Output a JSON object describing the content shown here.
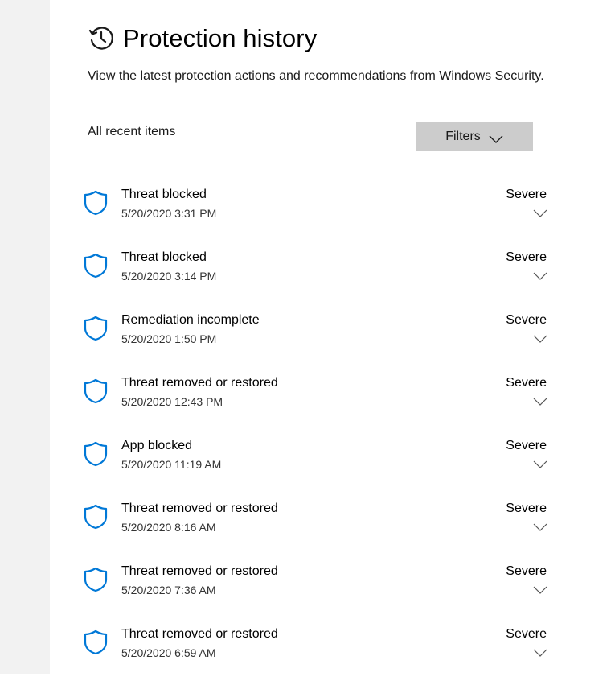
{
  "page": {
    "title": "Protection history",
    "description": "View the latest protection actions and recommendations from Windows Security.",
    "section_label": "All recent items",
    "filters_label": "Filters"
  },
  "icons": {
    "header": "history-clock-icon",
    "filters": "chevron-down-icon",
    "item": "shield-icon",
    "expand": "chevron-down-icon"
  },
  "colors": {
    "accent": "#0078d7",
    "sidebar": "#f2f2f2",
    "filters_bg": "#cccccc"
  },
  "items": [
    {
      "title": "Threat blocked",
      "time": "5/20/2020 3:31 PM",
      "severity": "Severe"
    },
    {
      "title": "Threat blocked",
      "time": "5/20/2020 3:14 PM",
      "severity": "Severe"
    },
    {
      "title": "Remediation incomplete",
      "time": "5/20/2020 1:50 PM",
      "severity": "Severe"
    },
    {
      "title": "Threat removed or restored",
      "time": "5/20/2020 12:43 PM",
      "severity": "Severe"
    },
    {
      "title": "App blocked",
      "time": "5/20/2020 11:19 AM",
      "severity": "Severe"
    },
    {
      "title": "Threat removed or restored",
      "time": "5/20/2020 8:16 AM",
      "severity": "Severe"
    },
    {
      "title": "Threat removed or restored",
      "time": "5/20/2020 7:36 AM",
      "severity": "Severe"
    },
    {
      "title": "Threat removed or restored",
      "time": "5/20/2020 6:59 AM",
      "severity": "Severe"
    }
  ]
}
